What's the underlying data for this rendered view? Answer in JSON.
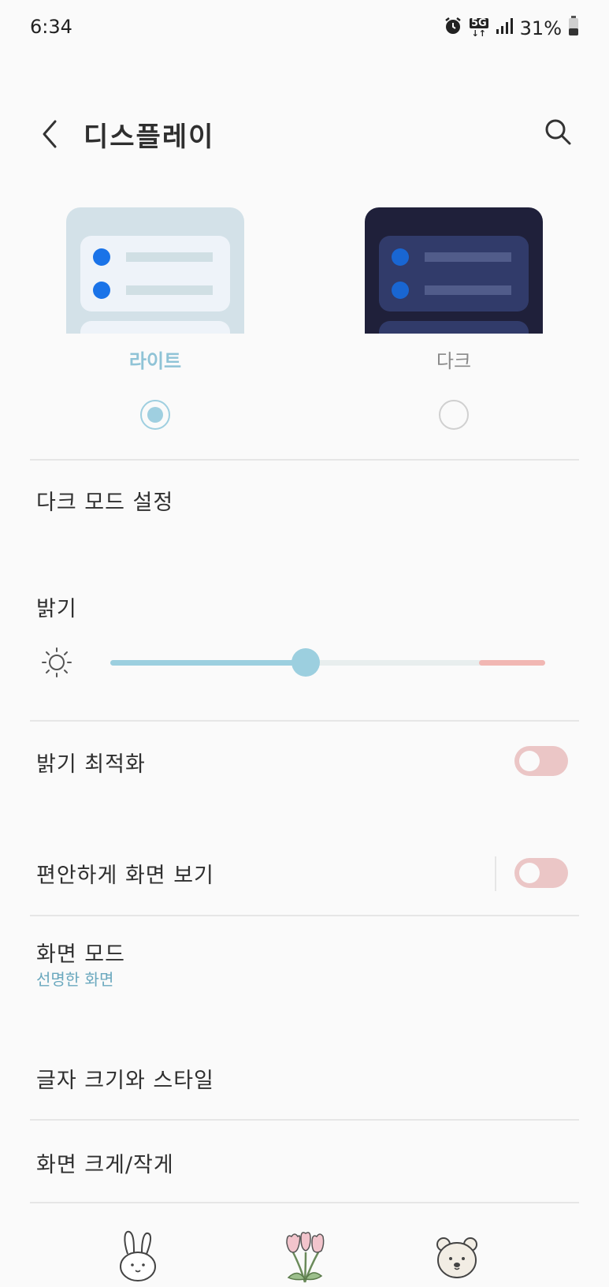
{
  "status_bar": {
    "time": "6:34",
    "network": "5G",
    "battery": "31%",
    "icons": [
      "alarm-icon",
      "5g-icon",
      "signal-icon",
      "battery-icon"
    ]
  },
  "header": {
    "title": "디스플레이",
    "back_icon": "chevron-left-icon",
    "search_icon": "search-icon"
  },
  "theme": {
    "options": [
      {
        "label": "라이트",
        "selected": true
      },
      {
        "label": "다크",
        "selected": false
      }
    ],
    "accent": "#9fcfe0"
  },
  "settings": {
    "dark_mode_settings": "다크 모드 설정",
    "brightness": {
      "label": "밝기",
      "icon": "sun-icon",
      "level": 0.45
    },
    "adaptive_brightness": {
      "label": "밝기 최적화",
      "enabled": false
    },
    "eye_comfort": {
      "label": "편안하게 화면 보기",
      "enabled": false
    },
    "screen_mode": {
      "label": "화면 모드",
      "value": "선명한 화면"
    },
    "font_size_style": "글자 크기와 스타일",
    "screen_zoom": "화면 크게/작게"
  },
  "bottom_nav": {
    "icons": [
      "rabbit-icon",
      "tulip-icon",
      "bear-icon"
    ]
  }
}
